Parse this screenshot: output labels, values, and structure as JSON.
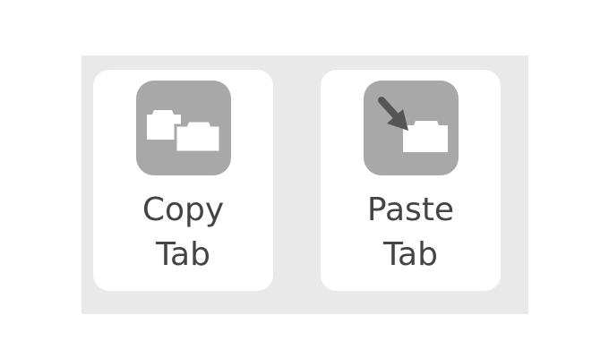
{
  "actions": [
    {
      "id": "copy-tab",
      "line1": "Copy",
      "line2": "Tab",
      "icon": "copy-tab-icon"
    },
    {
      "id": "paste-tab",
      "line1": "Paste",
      "line2": "Tab",
      "icon": "paste-tab-icon"
    }
  ],
  "colors": {
    "panel": "#e9e9e9",
    "card": "#ffffff",
    "icon_tile": "#a8a8a8",
    "arrow": "#555555",
    "label": "#444444"
  }
}
